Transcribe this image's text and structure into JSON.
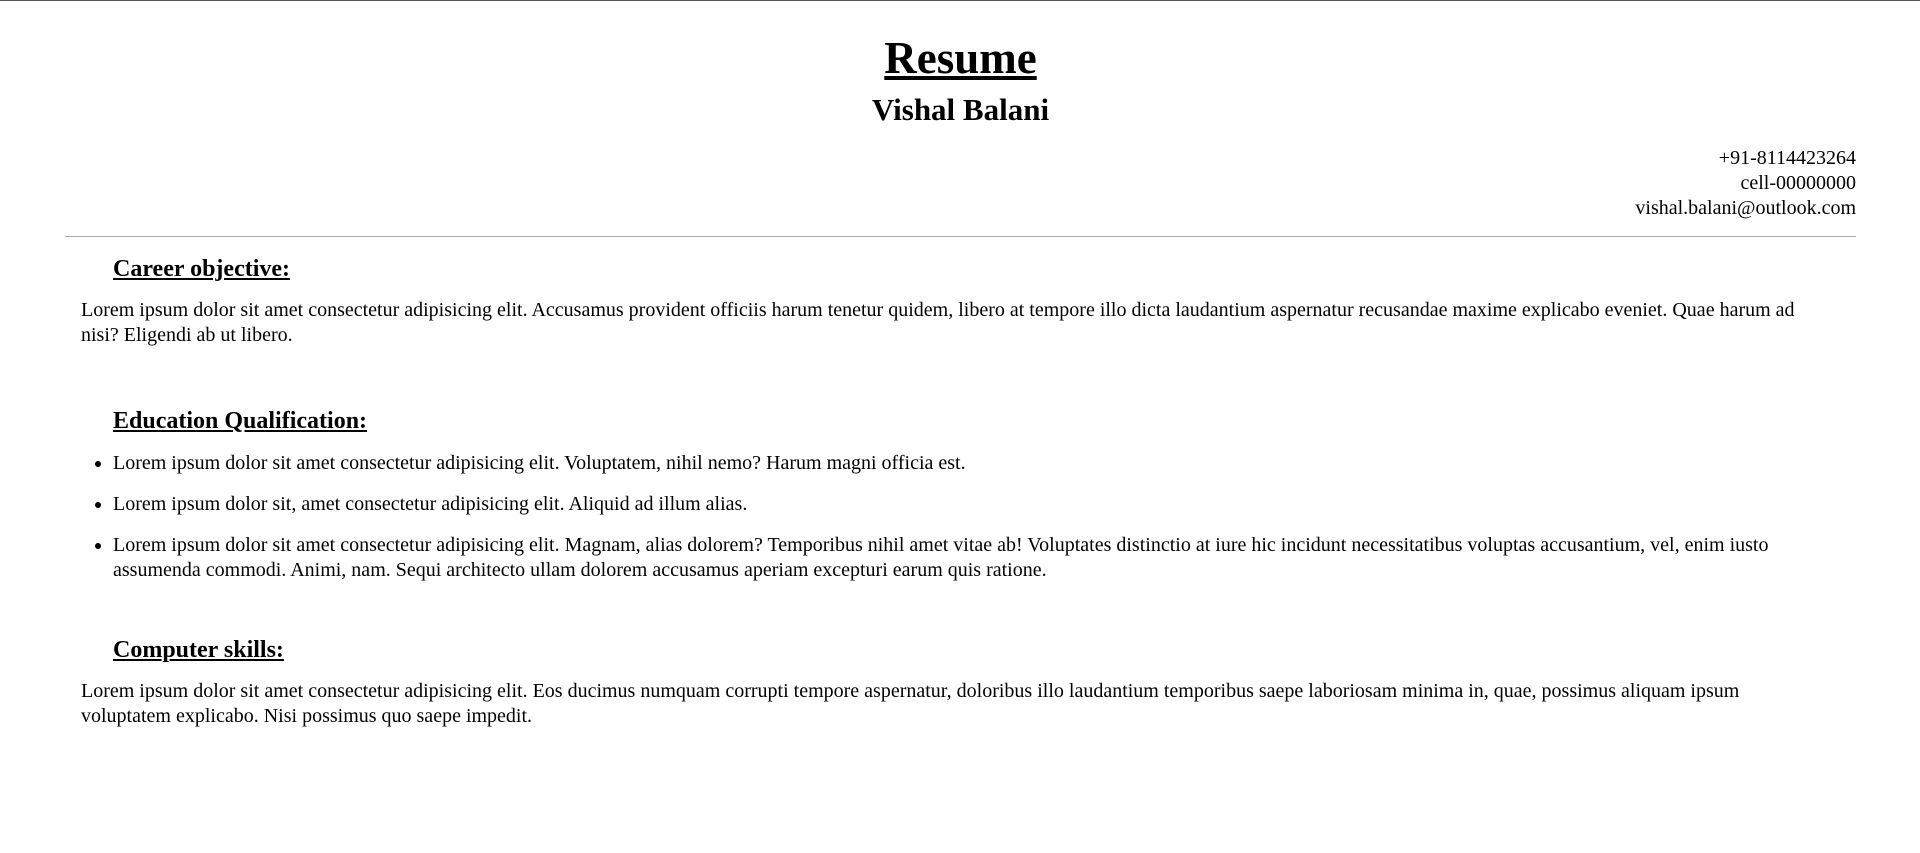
{
  "header": {
    "title": "Resume",
    "name": "Vishal Balani"
  },
  "contact": {
    "phone": "+91-8114423264",
    "cell": "cell-00000000",
    "email": "vishal.balani@outlook.com"
  },
  "career": {
    "heading": "Career objective:",
    "text": "Lorem ipsum dolor sit amet consectetur adipisicing elit. Accusamus provident officiis harum tenetur quidem, libero at tempore illo dicta laudantium aspernatur recusandae maxime explicabo eveniet. Quae harum ad nisi? Eligendi ab ut libero."
  },
  "education": {
    "heading": "Education Qualification:",
    "items": [
      "Lorem ipsum dolor sit amet consectetur adipisicing elit. Voluptatem, nihil nemo? Harum magni officia est.",
      "Lorem ipsum dolor sit, amet consectetur adipisicing elit. Aliquid ad illum alias.",
      "Lorem ipsum dolor sit amet consectetur adipisicing elit. Magnam, alias dolorem? Temporibus nihil amet vitae ab! Voluptates distinctio at iure hic incidunt necessitatibus voluptas accusantium, vel, enim iusto assumenda commodi. Animi, nam. Sequi architecto ullam dolorem accusamus aperiam excepturi earum quis ratione."
    ]
  },
  "skills": {
    "heading": "Computer skills:",
    "text": "Lorem ipsum dolor sit amet consectetur adipisicing elit. Eos ducimus numquam corrupti tempore aspernatur, doloribus illo laudantium temporibus saepe laboriosam minima in, quae, possimus aliquam ipsum voluptatem explicabo. Nisi possimus quo saepe impedit."
  }
}
